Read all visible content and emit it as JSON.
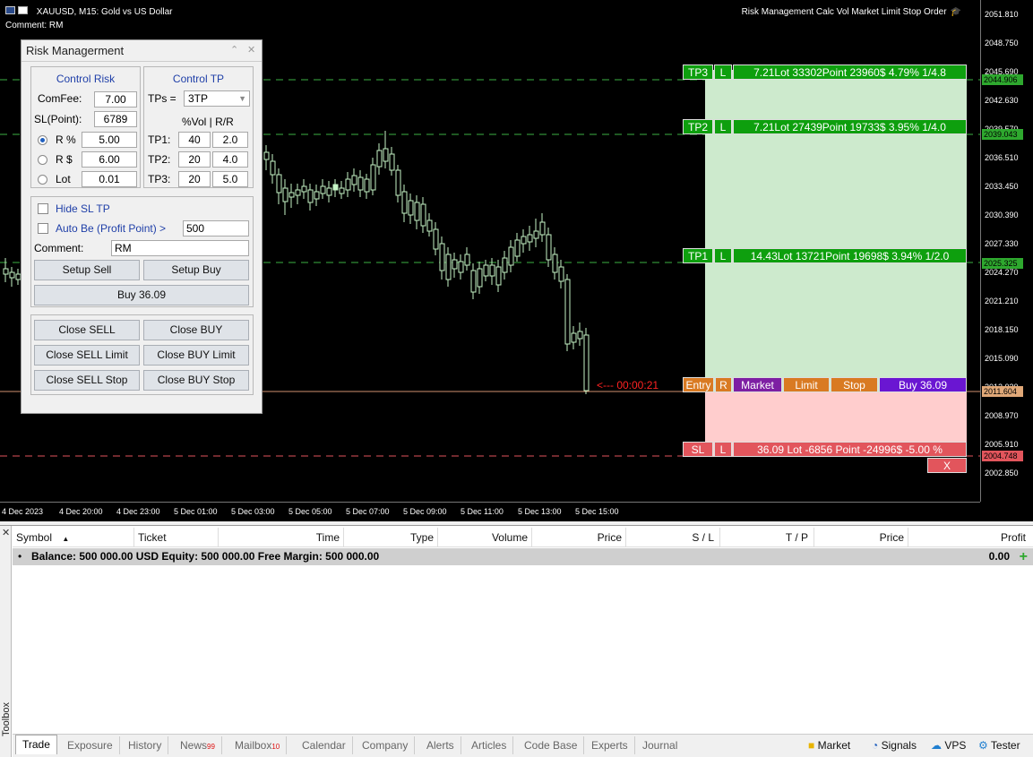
{
  "chart": {
    "symbol_line": "XAUUSD, M15:  Gold vs US Dollar",
    "comment_line": "Comment: RM",
    "ea_name": "Risk Management Calc Vol Market Limit Stop Order",
    "price_ticks": [
      "2051.810",
      "2048.750",
      "2045.690",
      "2042.630",
      "2039.570",
      "2036.510",
      "2033.450",
      "2030.390",
      "2027.330",
      "2024.270",
      "2021.210",
      "2018.150",
      "2015.090",
      "2012.030",
      "2008.970",
      "2005.910",
      "2002.850"
    ],
    "price_tags": [
      {
        "label": "2044.906",
        "color": "#2ea82e"
      },
      {
        "label": "2039.043",
        "color": "#2ea82e"
      },
      {
        "label": "2025.325",
        "color": "#2ea82e"
      },
      {
        "label": "2011.604",
        "color": "#e0a878"
      },
      {
        "label": "2004.748",
        "color": "#e2555c"
      }
    ],
    "time_ticks": [
      "4 Dec 2023",
      "4 Dec 20:00",
      "4 Dec 23:00",
      "5 Dec 01:00",
      "5 Dec 03:00",
      "5 Dec 05:00",
      "5 Dec 07:00",
      "5 Dec 09:00",
      "5 Dec 11:00",
      "5 Dec 13:00",
      "5 Dec 15:00"
    ],
    "countdown": "<--- 00:00:21",
    "tp3": {
      "name": "TP3",
      "l": "L",
      "info": "7.21Lot  33302Point  23960$  4.79%  1/4.8"
    },
    "tp2": {
      "name": "TP2",
      "l": "L",
      "info": "7.21Lot  27439Point  19733$  3.95%  1/4.0"
    },
    "tp1": {
      "name": "TP1",
      "l": "L",
      "info": "14.43Lot  13721Point  19698$  3.94%  1/2.0"
    },
    "entry": {
      "name": "Entry",
      "r": "R",
      "market": "Market",
      "limit": "Limit",
      "stop": "Stop",
      "buy": "Buy 36.09"
    },
    "sl": {
      "name": "SL",
      "l": "L",
      "info": "36.09 Lot  -6856 Point  -24996$  -5.00 %"
    },
    "close_x": "X",
    "colors": {
      "bull": "#c6f5c6",
      "tp_zone": "#cdeacd",
      "sl_zone": "#ffcdcd",
      "tp_line": "#3cb043",
      "entry_line": "#d08f6f",
      "sl_line": "#e2555c"
    }
  },
  "panel": {
    "title": "Risk Managerment",
    "minimize": "⌃",
    "close": "✕",
    "control_risk": {
      "title": "Control Risk",
      "comfee_label": "ComFee:",
      "comfee_value": "7.00",
      "sl_label": "SL(Point):",
      "sl_value": "6789",
      "r_pct_label": "R %",
      "r_pct_value": "5.00",
      "r_usd_label": "R $",
      "r_usd_value": "6.00",
      "lot_label": "Lot",
      "lot_value": "0.01"
    },
    "control_tp": {
      "title": "Control TP",
      "tps_label": "TPs =",
      "tps_value": "3TP",
      "header": "%Vol  |  R/R",
      "rows": [
        {
          "label": "TP1:",
          "vol": "40",
          "rr": "2.0"
        },
        {
          "label": "TP2:",
          "vol": "20",
          "rr": "4.0"
        },
        {
          "label": "TP3:",
          "vol": "20",
          "rr": "5.0"
        }
      ]
    },
    "hide_sl_tp": "Hide SL TP",
    "auto_be": "Auto Be (Profit Point) >",
    "auto_be_value": "500",
    "comment_label": "Comment:",
    "comment_value": "RM",
    "setup_sell": "Setup Sell",
    "setup_buy": "Setup Buy",
    "buy": "Buy 36.09",
    "close_sell": "Close SELL",
    "close_buy": "Close BUY",
    "close_sell_limit": "Close SELL Limit",
    "close_buy_limit": "Close BUY Limit",
    "close_sell_stop": "Close SELL Stop",
    "close_buy_stop": "Close BUY Stop"
  },
  "toolbox": {
    "close": "✕",
    "side_label": "Toolbox",
    "columns": [
      "Symbol",
      "Ticket",
      "Time",
      "Type",
      "Volume",
      "Price",
      "S / L",
      "T / P",
      "Price",
      "Profit"
    ],
    "sort_arrow": "▲",
    "balance_text": "Balance: 500 000.00 USD  Equity: 500 000.00  Free Margin: 500 000.00",
    "profit_total": "0.00",
    "tabs": [
      "Trade",
      "Exposure",
      "History",
      "News",
      "Mailbox",
      "Calendar",
      "Company",
      "Alerts",
      "Articles",
      "Code Base",
      "Experts",
      "Journal"
    ],
    "news_badge": "99",
    "mailbox_badge": "10",
    "right": [
      "Market",
      "Signals",
      "VPS",
      "Tester"
    ]
  }
}
